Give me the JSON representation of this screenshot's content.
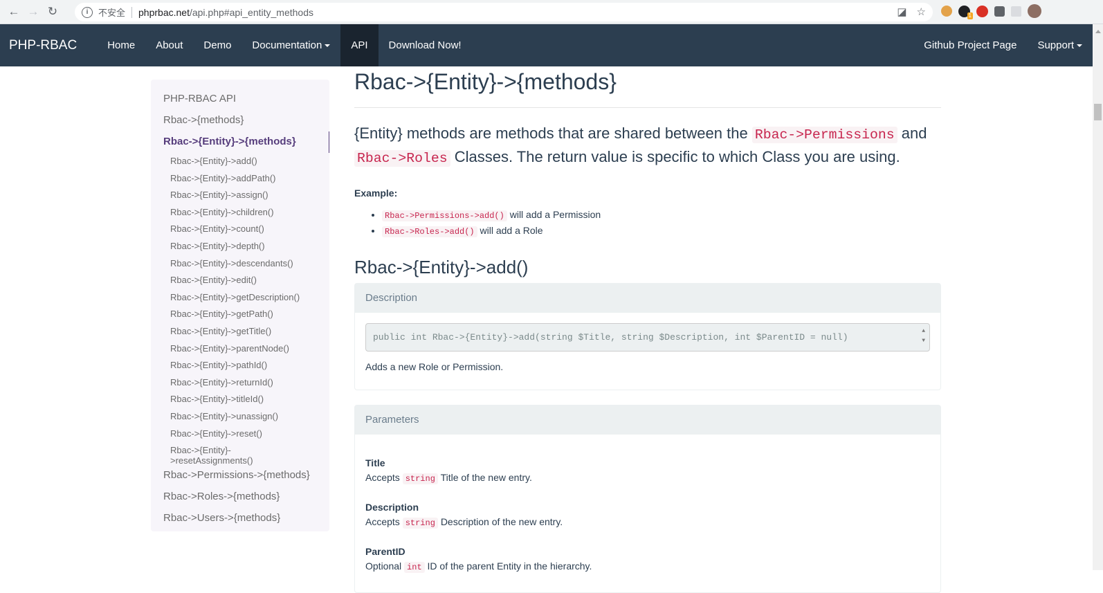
{
  "browser": {
    "insecure_label": "不安全",
    "url_host": "phprbac.net",
    "url_path": "/api.php#api_entity_methods"
  },
  "navbar": {
    "brand": "PHP-RBAC",
    "items": [
      "Home",
      "About",
      "Demo",
      "Documentation",
      "API",
      "Download Now!"
    ],
    "right_items": [
      "Github Project Page",
      "Support"
    ]
  },
  "sidebar": {
    "top_items": [
      "PHP-RBAC API",
      "Rbac->{methods}"
    ],
    "active": "Rbac->{Entity}->{methods}",
    "sub_items": [
      "Rbac->{Entity}->add()",
      "Rbac->{Entity}->addPath()",
      "Rbac->{Entity}->assign()",
      "Rbac->{Entity}->children()",
      "Rbac->{Entity}->count()",
      "Rbac->{Entity}->depth()",
      "Rbac->{Entity}->descendants()",
      "Rbac->{Entity}->edit()",
      "Rbac->{Entity}->getDescription()",
      "Rbac->{Entity}->getPath()",
      "Rbac->{Entity}->getTitle()",
      "Rbac->{Entity}->parentNode()",
      "Rbac->{Entity}->pathId()",
      "Rbac->{Entity}->returnId()",
      "Rbac->{Entity}->titleId()",
      "Rbac->{Entity}->unassign()",
      "Rbac->{Entity}->reset()",
      "Rbac->{Entity}->resetAssignments()"
    ],
    "bottom_items": [
      "Rbac->Permissions->{methods}",
      "Rbac->Roles->{methods}",
      "Rbac->Users->{methods}"
    ]
  },
  "main": {
    "title": "Rbac->{Entity}->{methods}",
    "lead_part1": "{Entity} methods are methods that are shared between the",
    "lead_code1": "Rbac->Permissions",
    "lead_part2": "and",
    "lead_code2": "Rbac->Roles",
    "lead_part3": "Classes. The return value is specific to which Class you are using.",
    "example_label": "Example:",
    "examples": [
      {
        "code": "Rbac->Permissions->add()",
        "text": "will add a Permission"
      },
      {
        "code": "Rbac->Roles->add()",
        "text": "will add a Role"
      }
    ],
    "section_title": "Rbac->{Entity}->add()",
    "description_heading": "Description",
    "signature": "public int Rbac->{Entity}->add(string $Title, string $Description, int $ParentID = null)",
    "description_text": "Adds a new Role or Permission.",
    "parameters_heading": "Parameters",
    "parameters": [
      {
        "name": "Title",
        "prefix": "Accepts",
        "type": "string",
        "text": "Title of the new entry."
      },
      {
        "name": "Description",
        "prefix": "Accepts",
        "type": "string",
        "text": "Description of the new entry."
      },
      {
        "name": "ParentID",
        "prefix": "Optional",
        "type": "int",
        "text": "ID of the parent Entity in the hierarchy."
      }
    ]
  }
}
